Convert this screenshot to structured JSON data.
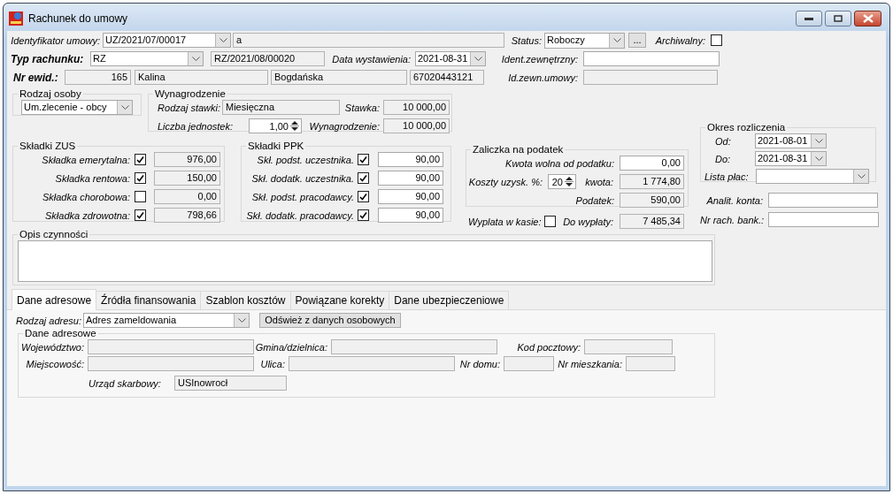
{
  "window": {
    "title": "Rachunek do umowy"
  },
  "contract": {
    "label": "Identyfikator umowy:",
    "value": "UZ/2021/07/00017",
    "name": {
      "value": "a",
      "readonly": true
    }
  },
  "status": {
    "label": "Status:",
    "value": "Roboczy",
    "button": "..."
  },
  "archived": {
    "label": "Archiwalny:",
    "checked": false
  },
  "bill_type": {
    "label": "Typ rachunku:",
    "value": "RZ",
    "number": {
      "value": "RZ/2021/08/00020",
      "readonly": true
    }
  },
  "issue_date": {
    "label": "Data wystawienia:",
    "value": "2021-08-31"
  },
  "external_id": {
    "label": "Ident.zewnętrzny:",
    "readonly": false
  },
  "record": {
    "label": "Nr ewid.:",
    "fields": [
      {
        "value": "165",
        "readonly": true
      },
      {
        "value": "Kalina",
        "readonly": true
      },
      {
        "value": "Bogdańska",
        "readonly": true
      },
      {
        "value": "67020443121",
        "readonly": true
      }
    ]
  },
  "contract_external_id": {
    "label": "Id.zewn.umowy:",
    "readonly": true
  },
  "person_type": {
    "title": "Rodzaj osoby",
    "value": "Um.zlecenie - obcy"
  },
  "salary": {
    "title": "Wynagrodzenie",
    "rate_type": {
      "label": "Rodzaj stawki:",
      "value": "Miesięczna",
      "readonly": true
    },
    "rate": {
      "label": "Stawka:",
      "value": "10 000,00",
      "readonly": true
    },
    "units": {
      "label": "Liczba jednostek:",
      "value": "1,00"
    },
    "amount": {
      "label": "Wynagrodzenie:",
      "value": "10 000,00",
      "readonly": true
    }
  },
  "zus": {
    "title": "Składki ZUS",
    "items": [
      {
        "label": "Składka emerytalna:",
        "checked": true,
        "value": "976,00",
        "readonly": true
      },
      {
        "label": "Składka rentowa:",
        "checked": true,
        "value": "150,00",
        "readonly": true
      },
      {
        "label": "Składka chorobowa:",
        "checked": false,
        "value": "0,00",
        "readonly": true
      },
      {
        "label": "Składka zdrowotna:",
        "checked": true,
        "value": "798,66",
        "readonly": true
      }
    ]
  },
  "ppk": {
    "title": "Składki PPK",
    "items": [
      {
        "label": "Skł. podst. uczestnika.",
        "checked": true,
        "value": "90,00",
        "readonly": false
      },
      {
        "label": "Skł. dodatk. uczestnika.",
        "checked": true,
        "value": "90,00",
        "readonly": false
      },
      {
        "label": "Skł. podst. pracodawcy.",
        "checked": true,
        "value": "90,00",
        "readonly": false
      },
      {
        "label": "Skł. dodatk. pracodawcy.",
        "checked": true,
        "value": "90,00",
        "readonly": false
      }
    ]
  },
  "tax": {
    "title": "Zaliczka na podatek",
    "free_amount": {
      "label": "Kwota wolna od podatku:",
      "value": "0,00",
      "readonly": false
    },
    "costs": {
      "label": "Koszty uzysk. %:",
      "value": "20"
    },
    "costs_amount": {
      "label": "kwota:",
      "value": "1 774,80",
      "readonly": true
    },
    "tax_amount": {
      "label": "Podatek:",
      "value": "590,00",
      "readonly": true
    }
  },
  "cash_payment": {
    "label": "Wyplata w kasie:",
    "checked": false
  },
  "to_pay": {
    "label": "Do wypłaty:",
    "value": "7 485,34",
    "readonly": true
  },
  "period": {
    "title": "Okres rozliczenia",
    "from": {
      "label": "Od:",
      "value": "2021-08-01"
    },
    "to": {
      "label": "Do:",
      "value": "2021-08-31"
    },
    "payroll": {
      "label": "Lista płac:"
    }
  },
  "account_analytic": {
    "label": "Analit. konta:",
    "readonly": false
  },
  "bank_account": {
    "label": "Nr rach. bank.:",
    "readonly": false
  },
  "description": {
    "title": "Opis czynności"
  },
  "tabs": [
    {
      "label": "Dane adresowe",
      "selected": true
    },
    {
      "label": "Źródła finansowania",
      "selected": false
    },
    {
      "label": "Szablon kosztów",
      "selected": false
    },
    {
      "label": "Powiązane korekty",
      "selected": false
    },
    {
      "label": "Dane ubezpieczeniowe",
      "selected": false
    }
  ],
  "address": {
    "type": {
      "label": "Rodzaj adresu:",
      "value": "Adres zameldowania"
    },
    "refresh_button": "Odśwież z danych osobowych",
    "title": "Dane adresowe",
    "voivodeship": {
      "label": "Województwo:",
      "readonly": true
    },
    "commune": {
      "label": "Gmina/dzielnica:",
      "readonly": true
    },
    "postal_code": {
      "label": "Kod pocztowy:",
      "readonly": true
    },
    "city": {
      "label": "Miejscowość:",
      "readonly": true
    },
    "street": {
      "label": "Ulica:",
      "readonly": true
    },
    "house_no": {
      "label": "Nr domu:",
      "readonly": true
    },
    "flat_no": {
      "label": "Nr mieszkania:",
      "readonly": true
    },
    "tax_office": {
      "label": "Urząd skarbowy:",
      "value": "USInowrocł",
      "readonly": true
    }
  }
}
